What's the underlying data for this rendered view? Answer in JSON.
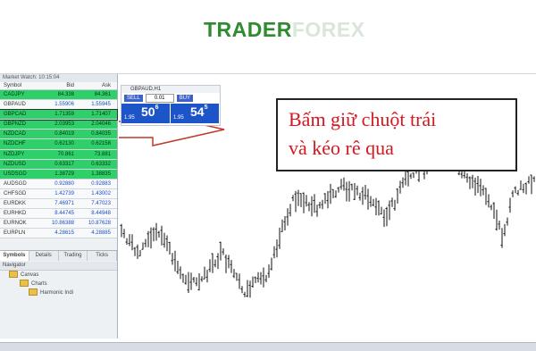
{
  "logo": {
    "part1": "TRADER",
    "part2": "FOREX"
  },
  "market_watch": {
    "title": "Market Watch: 10:15:04",
    "columns": [
      "Symbol",
      "Bid",
      "Ask"
    ],
    "rows": [
      {
        "symbol": "CADJPY",
        "bid": "84.338",
        "ask": "84.361",
        "color": "green"
      },
      {
        "symbol": "GBPAUD",
        "bid": "1.55906",
        "ask": "1.55945",
        "color": "white"
      },
      {
        "symbol": "GBPCAD",
        "bid": "1.71359",
        "ask": "1.71407",
        "color": "green",
        "selected": true
      },
      {
        "symbol": "GBPNZD",
        "bid": "2.03953",
        "ask": "2.04046",
        "color": "green"
      },
      {
        "symbol": "NZDCAD",
        "bid": "0.84019",
        "ask": "0.84035",
        "color": "green"
      },
      {
        "symbol": "NZDCHF",
        "bid": "0.62130",
        "ask": "0.62158",
        "color": "green"
      },
      {
        "symbol": "NZDJPY",
        "bid": "70.861",
        "ask": "73.881",
        "color": "green"
      },
      {
        "symbol": "NZDUSD",
        "bid": "0.63317",
        "ask": "0.63332",
        "color": "green"
      },
      {
        "symbol": "USDSGD",
        "bid": "1.38729",
        "ask": "1.38835",
        "color": "green"
      },
      {
        "symbol": "AUDSGD",
        "bid": "0.92880",
        "ask": "0.92883",
        "color": "white"
      },
      {
        "symbol": "CHFSGD",
        "bid": "1.42739",
        "ask": "1.43002",
        "color": "white"
      },
      {
        "symbol": "EURDKK",
        "bid": "7.46971",
        "ask": "7.47023",
        "color": "white"
      },
      {
        "symbol": "EURHKD",
        "bid": "8.44745",
        "ask": "8.44948",
        "color": "white"
      },
      {
        "symbol": "EURNOK",
        "bid": "10.86388",
        "ask": "10.87628",
        "color": "white"
      },
      {
        "symbol": "EURPLN",
        "bid": "4.28615",
        "ask": "4.28885",
        "color": "white"
      }
    ],
    "tabs": [
      "Symbols",
      "Details",
      "Trading",
      "Ticks"
    ]
  },
  "navigator": {
    "title": "Navigator",
    "items": [
      "Canvas",
      "Charts",
      "Harmonic Indi"
    ]
  },
  "trade_panel": {
    "symbol": "GBPAUD,H1",
    "sell_label": "SELL",
    "buy_label": "BUY",
    "lot": "0.01",
    "sell_prefix": "1.95",
    "sell_big": "50",
    "sell_sup": "6",
    "buy_prefix": "1.95",
    "buy_big": "54",
    "buy_sup": "5"
  },
  "callout": {
    "line1": "Bấm giữ chuột trái",
    "line2": "và kéo rê qua"
  },
  "colors": {
    "logo_green": "#2e8b2e",
    "callout_text": "#d4181f",
    "row_green": "#2fd069"
  }
}
